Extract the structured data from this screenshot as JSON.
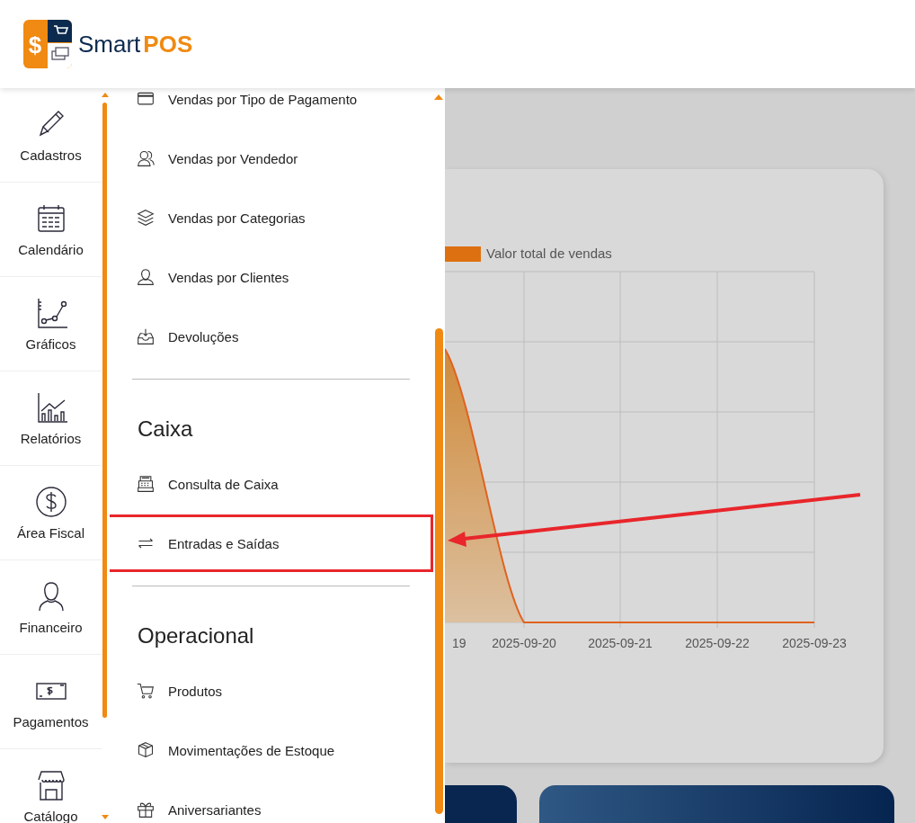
{
  "header": {
    "logo_mark": "$",
    "brand": "Smart",
    "brand_accent": "POS"
  },
  "rail": {
    "items": [
      {
        "label": "Cadastros",
        "kind": "pencil"
      },
      {
        "label": "Calendário",
        "kind": "calendar"
      },
      {
        "label": "Gráficos",
        "kind": "linechart"
      },
      {
        "label": "Relatórios",
        "kind": "barchart"
      },
      {
        "label": "Área Fiscal",
        "kind": "dollar"
      },
      {
        "label": "Financeiro",
        "kind": "person"
      },
      {
        "label": "Pagamentos",
        "kind": "banknote"
      },
      {
        "label": "Catálogo",
        "kind": "store"
      }
    ]
  },
  "submenu": {
    "sections": [
      {
        "items": [
          {
            "label": "Vendas por Tipo de Pagamento",
            "kind": "card",
            "highlighted": false
          },
          {
            "label": "Vendas por Vendedor",
            "kind": "people",
            "highlighted": false
          },
          {
            "label": "Vendas por Categorias",
            "kind": "layers",
            "highlighted": false
          },
          {
            "label": "Vendas por Clientes",
            "kind": "person",
            "highlighted": false
          },
          {
            "label": "Devoluções",
            "kind": "inbox",
            "highlighted": false
          }
        ]
      },
      {
        "title": "Caixa",
        "items": [
          {
            "label": "Consulta de Caixa",
            "kind": "register",
            "highlighted": false
          },
          {
            "label": "Entradas e Saídas",
            "kind": "arrows",
            "highlighted": true
          }
        ]
      },
      {
        "title": "Operacional",
        "items": [
          {
            "label": "Produtos",
            "kind": "cart",
            "highlighted": false
          },
          {
            "label": "Movimentações de Estoque",
            "kind": "box",
            "highlighted": false
          },
          {
            "label": "Aniversariantes",
            "kind": "gift",
            "highlighted": false
          }
        ]
      }
    ]
  },
  "chart": {
    "legend": "Valor total de vendas",
    "x_labels": [
      "19",
      "2025-09-20",
      "2025-09-21",
      "2025-09-22",
      "2025-09-23"
    ]
  }
}
